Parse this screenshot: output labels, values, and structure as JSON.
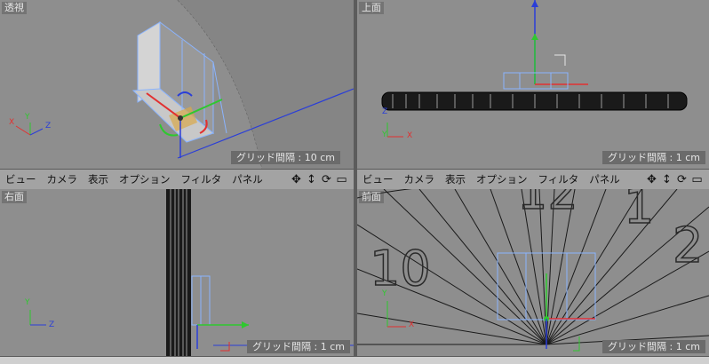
{
  "viewports": {
    "perspective": {
      "label": "透視",
      "grid": "グリッド間隔 : 10 cm"
    },
    "top": {
      "label": "上面",
      "grid": "グリッド間隔 : 1 cm"
    },
    "right": {
      "label": "右面",
      "grid": "グリッド間隔 : 1 cm"
    },
    "front": {
      "label": "前面",
      "grid": "グリッド間隔 : 1 cm"
    }
  },
  "menu": [
    "ビュー",
    "カメラ",
    "表示",
    "オプション",
    "フィルタ",
    "パネル"
  ],
  "nav_icons": [
    "move-view-icon",
    "dolly-view-icon",
    "rotate-view-icon",
    "toggle-layout-icon"
  ],
  "clock_numbers": [
    "10",
    "12",
    "1",
    "2"
  ],
  "axis_labels": {
    "x": "X",
    "y": "Y",
    "z": "Z"
  },
  "colors": {
    "x_axis": "#e23030",
    "y_axis": "#2fc82f",
    "z_axis": "#2a3ed8",
    "selection": "#8ab4ff"
  }
}
